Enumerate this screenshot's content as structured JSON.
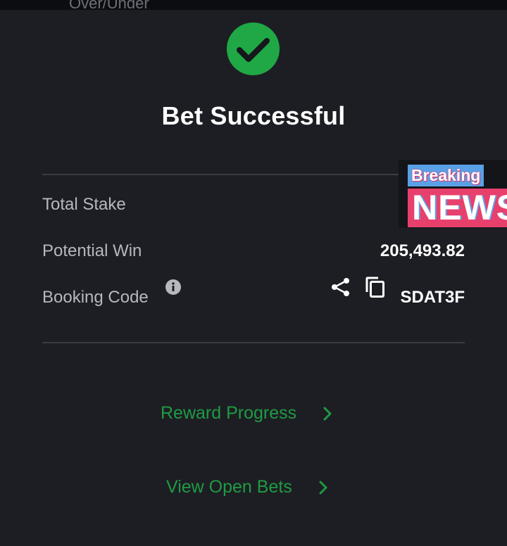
{
  "header": {
    "partial_label": "Over/Under"
  },
  "modal": {
    "title": "Bet Successful",
    "rows": [
      {
        "label": "Total Stake",
        "value": ""
      },
      {
        "label": "Potential Win",
        "value": "205,493.82"
      },
      {
        "label": "Booking Code",
        "value": "SDAT3F"
      }
    ],
    "links": [
      {
        "label": "Reward Progress"
      },
      {
        "label": "View Open Bets"
      }
    ]
  },
  "overlay": {
    "line1": "Breaking",
    "line2": "NEWS"
  },
  "colors": {
    "background": "#1d1e23",
    "success_green": "#1fa845",
    "link_green": "#1e9b43",
    "muted_text": "#b6b8bf",
    "news_blue": "#5aa0e6",
    "news_pink": "#e8406d"
  },
  "icons": [
    "check-circle-icon",
    "info-icon",
    "share-icon",
    "copy-icon",
    "chevron-right-icon"
  ]
}
